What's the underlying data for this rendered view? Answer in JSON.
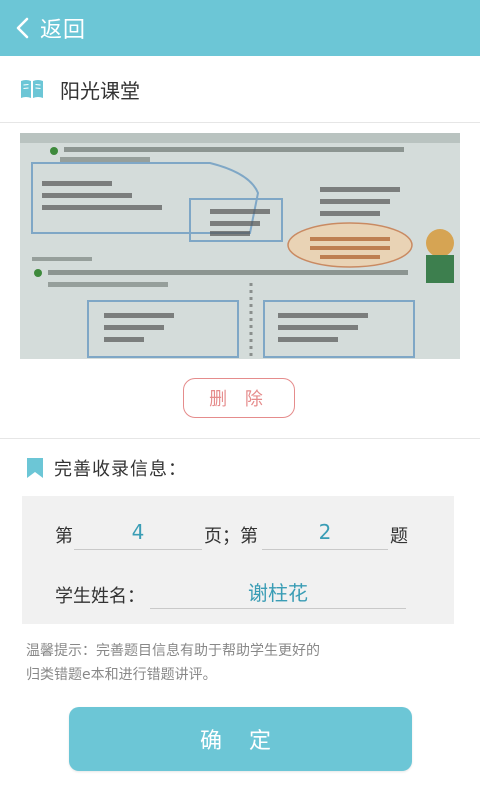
{
  "header": {
    "back_label": "返回",
    "back_icon": "chevron-left-icon",
    "color": "#6cc6d6"
  },
  "course": {
    "icon": "book-icon",
    "title": "阳光课堂"
  },
  "photo": {
    "delete_label": "删 除",
    "delete_color": "#e58c8c"
  },
  "info": {
    "icon": "bookmark-icon",
    "title": "完善收录信息：",
    "page_prefix": "第",
    "page_value": "4",
    "page_suffix": "页；第",
    "question_value": "2",
    "question_suffix": "题",
    "student_label": "学生姓名：",
    "student_value": "谢柱花"
  },
  "tip": {
    "line1": "温馨提示：完善题目信息有助于帮助学生更好的",
    "line2": "归类错题e本和进行错题讲评。"
  },
  "confirm_label": "确 定"
}
